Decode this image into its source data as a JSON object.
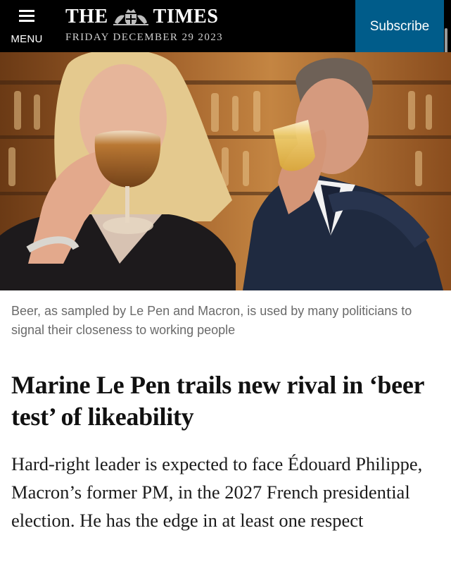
{
  "header": {
    "menu_label": "MENU",
    "masthead_left": "THE",
    "masthead_right": "TIMES",
    "date": "FRIDAY DECEMBER 29 2023",
    "subscribe_label": "Subscribe"
  },
  "colors": {
    "header_bg": "#000000",
    "subscribe_bg": "#005c8a",
    "caption_text": "#6a6a6a",
    "headline_text": "#111111"
  },
  "article": {
    "caption": "Beer, as sampled by Le Pen and Macron, is used by many politicians to signal their closeness to working people",
    "headline": "Marine Le Pen trails new rival in ‘beer test’ of likeability",
    "standfirst": "Hard-right leader is expected to face Édouard Philippe, Macron’s former PM, in the 2027 French presidential election. He has the edge in at least one respect"
  },
  "icons": {
    "menu": "hamburger-icon",
    "crest": "royal-crest-icon"
  }
}
